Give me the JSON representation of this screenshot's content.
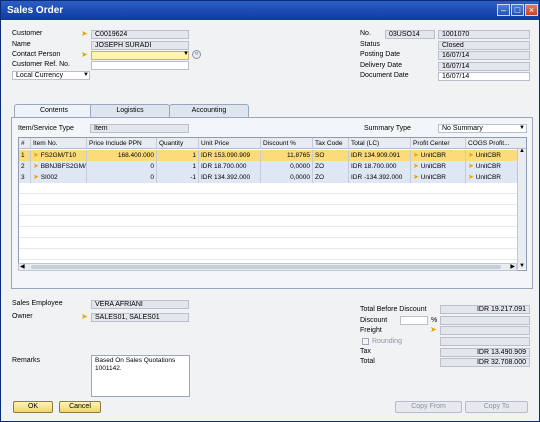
{
  "window": {
    "title": "Sales Order"
  },
  "header_left": {
    "customer_label": "Customer",
    "customer_value": "C0019624",
    "name_label": "Name",
    "name_value": "JOSEPH SURADI",
    "contact_label": "Contact Person",
    "contact_value": "",
    "ref_label": "Customer Ref. No.",
    "ref_value": "",
    "currency_value": "Local Currency"
  },
  "header_right": {
    "no_label": "No.",
    "series_value": "03USO14",
    "doc_number": "1001070",
    "status_label": "Status",
    "status_value": "Closed",
    "posting_label": "Posting Date",
    "posting_value": "16/07/14",
    "delivery_label": "Delivery Date",
    "delivery_value": "16/07/14",
    "docdate_label": "Document Date",
    "docdate_value": "16/07/14"
  },
  "tabs": [
    "Contents",
    "Logistics",
    "Accounting"
  ],
  "contents": {
    "item_type_label": "Item/Service Type",
    "item_type_value": "Item",
    "summary_label": "Summary Type",
    "summary_value": "No Summary"
  },
  "grid": {
    "columns": [
      "#",
      "Item No.",
      "Price Include PPN",
      "Quantity",
      "Unit Price",
      "Discount %",
      "Tax Code",
      "Total (LC)",
      "Profit Center",
      "COGS Profit..."
    ],
    "rows": [
      [
        "1",
        "FS2GM/T10",
        "168.400.000",
        "1",
        "IDR 153.090.909",
        "11,8765",
        "SO",
        "IDR 134.909.091",
        "UnitCBR",
        "UnitCBR"
      ],
      [
        "2",
        "BBNJBFS2GM/",
        "0",
        "1",
        "IDR 18.700.000",
        "0,0000",
        "ZO",
        "IDR 18.700.000",
        "UnitCBR",
        "UnitCBR"
      ],
      [
        "3",
        "SI002",
        "0",
        "-1",
        "IDR 134.392.000",
        "0,0000",
        "ZO",
        "IDR -134.392.000",
        "UnitCBR",
        "UnitCBR"
      ]
    ]
  },
  "footer_left": {
    "employee_label": "Sales Employee",
    "employee_value": "VERA AFRIANI",
    "owner_label": "Owner",
    "owner_value": "SALES01, SALES01",
    "remarks_label": "Remarks",
    "remarks_value": "Based On Sales Quotations 1001142."
  },
  "totals": {
    "before_label": "Total Before Discount",
    "before_value": "IDR 19.217.091",
    "discount_label": "Discount",
    "discount_pct_symbol": "%",
    "freight_label": "Freight",
    "rounding_label": "Rounding",
    "tax_label": "Tax",
    "tax_value": "IDR 13.490.909",
    "total_label": "Total",
    "total_value": "IDR 32.708.000"
  },
  "buttons": {
    "ok": "OK",
    "cancel": "Cancel",
    "copy_from": "Copy From",
    "copy_to": "Copy To"
  }
}
